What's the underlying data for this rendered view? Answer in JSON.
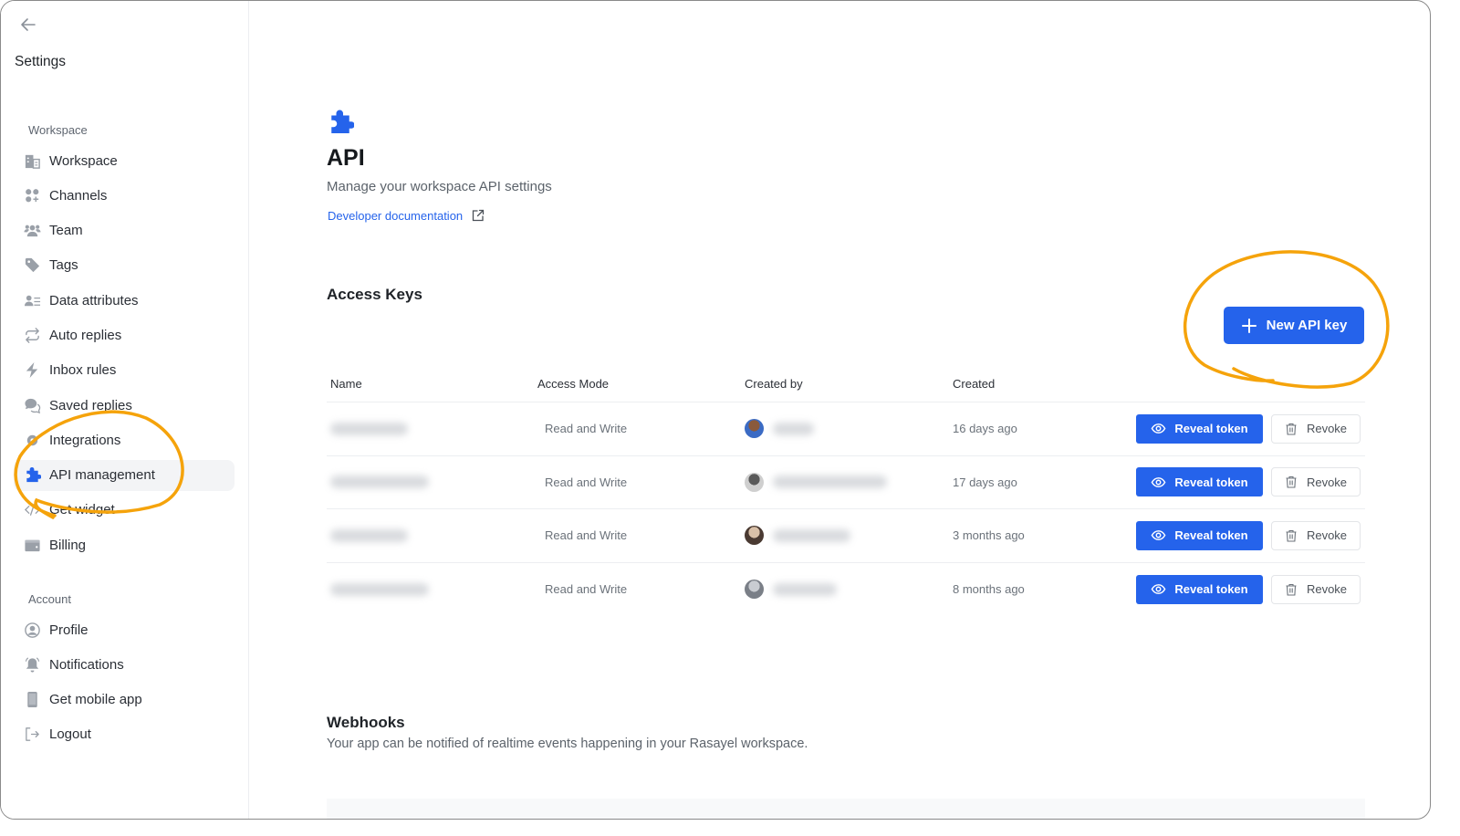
{
  "sidebar": {
    "back_icon": "arrow-left-icon",
    "title": "Settings",
    "workspace_section": "Workspace",
    "workspace_items": [
      {
        "label": "Workspace",
        "icon": "building-icon"
      },
      {
        "label": "Channels",
        "icon": "channels-icon"
      },
      {
        "label": "Team",
        "icon": "team-icon"
      },
      {
        "label": "Tags",
        "icon": "tag-icon"
      },
      {
        "label": "Data attributes",
        "icon": "data-attributes-icon"
      },
      {
        "label": "Auto replies",
        "icon": "repeat-icon"
      },
      {
        "label": "Inbox rules",
        "icon": "bolt-icon"
      },
      {
        "label": "Saved replies",
        "icon": "chat-bubbles-icon"
      },
      {
        "label": "Integrations",
        "icon": "gear-icon"
      },
      {
        "label": "API management",
        "icon": "puzzle-icon",
        "active": true
      },
      {
        "label": "Get widget",
        "icon": "code-icon"
      },
      {
        "label": "Billing",
        "icon": "wallet-icon"
      }
    ],
    "account_section": "Account",
    "account_items": [
      {
        "label": "Profile",
        "icon": "user-circle-icon"
      },
      {
        "label": "Notifications",
        "icon": "bell-icon"
      },
      {
        "label": "Get mobile app",
        "icon": "phone-icon"
      },
      {
        "label": "Logout",
        "icon": "logout-icon"
      }
    ]
  },
  "main": {
    "icon": "puzzle-icon",
    "title": "API",
    "subtitle": "Manage your workspace API settings",
    "doc_link": "Developer documentation",
    "access_keys": {
      "title": "Access Keys",
      "new_button": "New API key",
      "columns": [
        "Name",
        "Access Mode",
        "Created by",
        "Created"
      ],
      "rows": [
        {
          "name": "[blurred]",
          "access_mode": "Read and Write",
          "created_by": "[blurred]",
          "created": "16 days ago"
        },
        {
          "name": "[blurred]",
          "access_mode": "Read and Write",
          "created_by": "[blurred]",
          "created": "17 days ago"
        },
        {
          "name": "[blurred]",
          "access_mode": "Read and Write",
          "created_by": "[blurred]",
          "created": "3 months ago"
        },
        {
          "name": "[blurred]",
          "access_mode": "Read and Write",
          "created_by": "[blurred]",
          "created": "8 months ago"
        }
      ],
      "reveal_label": "Reveal token",
      "revoke_label": "Revoke"
    },
    "webhooks": {
      "title": "Webhooks",
      "description": "Your app can be notified of realtime events happening in your Rasayel workspace."
    }
  },
  "colors": {
    "accent": "#2563eb",
    "annotation": "#f5a30b"
  }
}
